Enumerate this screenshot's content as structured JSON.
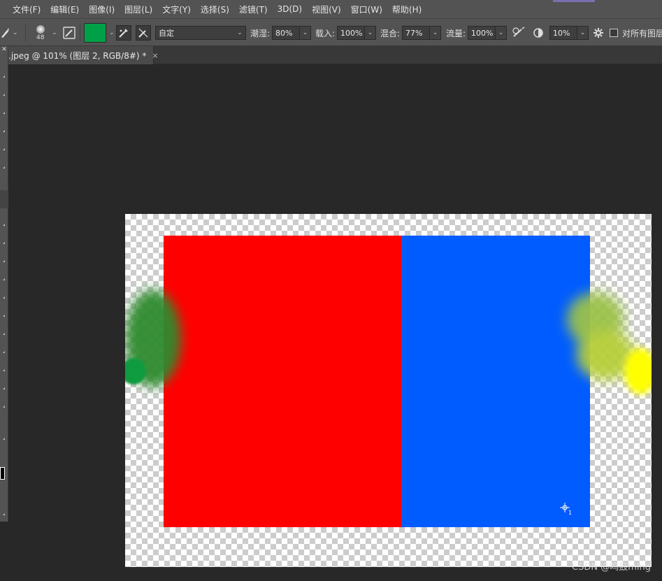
{
  "menu": [
    "文件(F)",
    "编辑(E)",
    "图像(I)",
    "图层(L)",
    "文字(Y)",
    "选择(S)",
    "滤镜(T)",
    "3D(D)",
    "视图(V)",
    "窗口(W)",
    "帮助(H)"
  ],
  "options": {
    "brush_size": "48",
    "mode_value": "自定",
    "wetness_label": "潮湿:",
    "wetness_value": "80%",
    "load_label": "载入:",
    "load_value": "100%",
    "mix_label": "混合:",
    "mix_value": "77%",
    "flow_label": "流量:",
    "flow_value": "100%",
    "angle_value": "10%",
    "sample_all_label": "对所有图层"
  },
  "document": {
    "tab_title": ".jpeg @ 101% (图层 2, RGB/8#) *",
    "close": "×"
  },
  "cursor_sub": "1",
  "watermark": "CSDN @鸣鼓ming",
  "colors": {
    "foreground": "#00a048",
    "red_block": "#ff0000",
    "blue_block": "#005cff",
    "green_smudge": "#2f8b2f",
    "yellow_smudge": "#ffff00",
    "olive_smudge": "#9cc24a"
  }
}
